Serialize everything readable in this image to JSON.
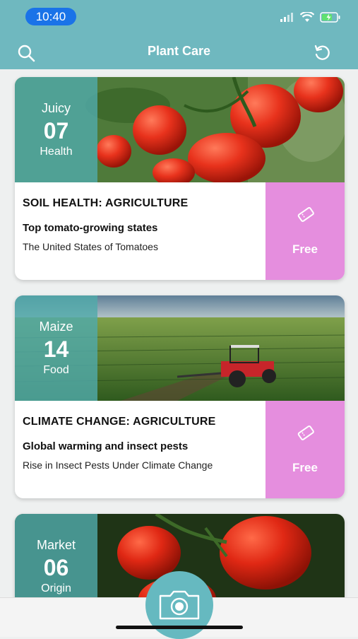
{
  "status": {
    "time": "10:40"
  },
  "header": {
    "title": "Plant Care"
  },
  "cards": [
    {
      "date_top": "Juicy",
      "date_num": "07",
      "date_bottom": "Health",
      "category": "SOIL HEALTH: AGRICULTURE",
      "headline": "Top tomato-growing states",
      "subtitle": "The United States of Tomatoes",
      "price": "Free",
      "image": "tomato-vine-photo"
    },
    {
      "date_top": "Maize",
      "date_num": "14",
      "date_bottom": "Food",
      "category": "CLIMATE CHANGE: AGRICULTURE",
      "headline": "Global warming and insect pests",
      "subtitle": "Rise in Insect Pests Under Climate Change",
      "price": "Free",
      "image": "tractor-field-photo"
    },
    {
      "date_top": "Market",
      "date_num": "06",
      "date_bottom": "Origin",
      "image": "tomato-cluster-photo"
    }
  ],
  "colors": {
    "header": "#6fb8bf",
    "price_bg": "#e58ede",
    "date_panel": "#50aaaa"
  }
}
